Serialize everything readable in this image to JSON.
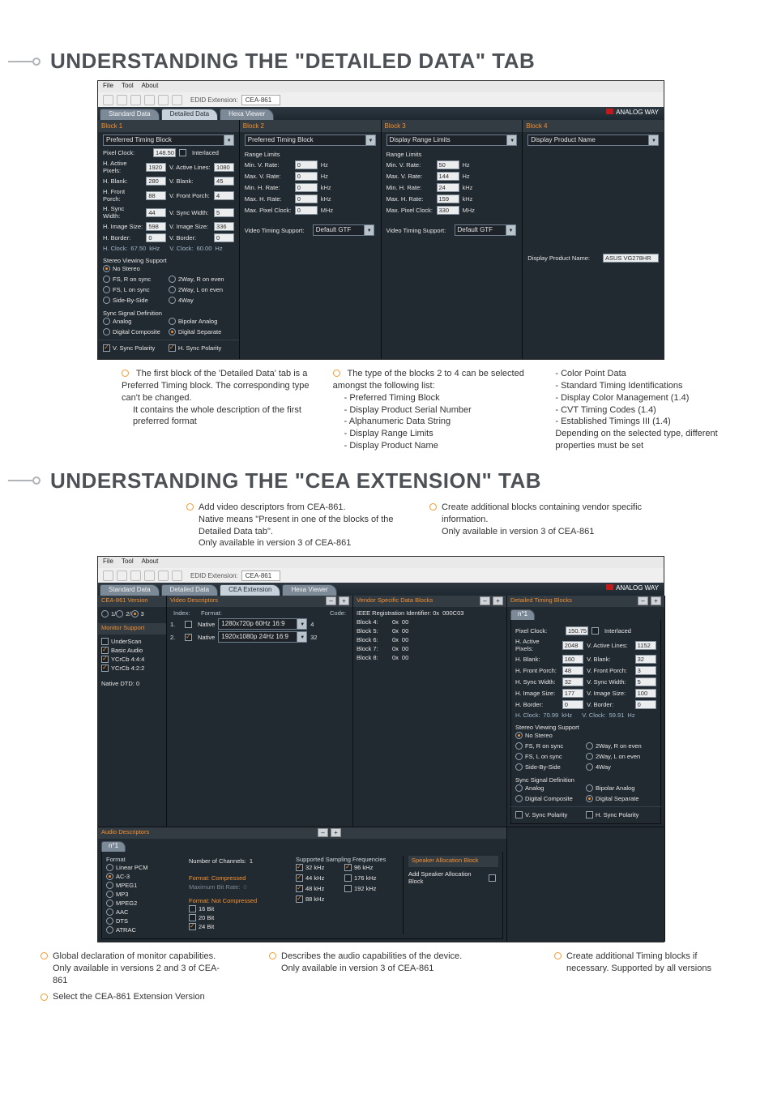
{
  "headings": {
    "h1": "UNDERSTANDING THE \"DETAILED DATA\" TAB",
    "h2": "UNDERSTANDING THE \"CEA EXTENSION\" TAB"
  },
  "menubar": {
    "file": "File",
    "tool": "Tool",
    "about": "About"
  },
  "toolbar": {
    "ext_label": "EDID Extension:",
    "ext_value": "CEA-861"
  },
  "brand": "ANALOG WAY",
  "detailed": {
    "tabs": {
      "standard": "Standard Data",
      "detailed": "Detailed Data",
      "hexa": "Hexa Viewer"
    },
    "blocks": {
      "b1": {
        "title": "Block 1",
        "type": "Preferred Timing Block",
        "pixelClock": "148.50",
        "interlaced": "Interlaced",
        "hActive": "1920",
        "vActive": "1080",
        "hBlank": "280",
        "vBlank": "45",
        "hFront": "88",
        "vFront": "4",
        "hSync": "44",
        "vSync": "5",
        "hImg": "598",
        "vImg": "336",
        "hBorder": "0",
        "vBorder": "0",
        "hClock": "67.50",
        "vClock": "60.00",
        "labels": {
          "pixelClock": "Pixel Clock:",
          "interlaced": "Interlaced",
          "hActive": "H. Active Pixels:",
          "vActive": "V. Active Lines:",
          "hBlank": "H. Blank:",
          "vBlank": "V. Blank:",
          "hFront": "H. Front Porch:",
          "vFront": "V. Front Porch:",
          "hSync": "H. Sync Width:",
          "vSync": "V. Sync Width:",
          "hImg": "H. Image Size:",
          "vImg": "V. Image Size:",
          "hBorder": "H. Border:",
          "vBorder": "V. Border:",
          "hClockPre": "H. Clock:",
          "hClockSuf": "kHz",
          "vClockPre": "V. Clock:",
          "vClockSuf": "Hz"
        },
        "stereoHead": "Stereo Viewing Support",
        "stereo": [
          "No Stereo",
          "FS, R on sync",
          "2Way, R on even",
          "FS, L on sync",
          "2Way, L on even",
          "Side-By-Side",
          "4Way"
        ],
        "syncHead": "Sync Signal Definition",
        "sync": [
          "Analog",
          "Bipolar Analog",
          "Digital Composite",
          "Digital Separate"
        ],
        "vpol": "V. Sync Polarity",
        "hpol": "H. Sync Polarity"
      },
      "b2": {
        "title": "Block 2",
        "type": "Preferred Timing Block",
        "head": "Range Limits",
        "minV": "0",
        "maxV": "0",
        "minH": "0",
        "maxH": "0",
        "maxP": "0",
        "labels": {
          "minV": "Min. V. Rate:",
          "maxV": "Max. V. Rate:",
          "minH": "Min. H. Rate:",
          "maxH": "Max. H. Rate:",
          "maxP": "Max. Pixel Clock:"
        },
        "units": {
          "hz": "Hz",
          "khz": "kHz",
          "mhz": "MHz"
        },
        "vts_l": "Video Timing Support:",
        "vts_v": "Default GTF"
      },
      "b3": {
        "title": "Block 3",
        "type": "Display Range Limits",
        "head": "Range Limits",
        "minV": "50",
        "maxV": "144",
        "minH": "24",
        "maxH": "159",
        "maxP": "330",
        "vts_l": "Video Timing Support:",
        "vts_v": "Default GTF"
      },
      "b4": {
        "title": "Block 4",
        "type": "Display Product Name",
        "dp_label": "Display Product Name:",
        "dp_value": "ASUS VG278HR"
      }
    }
  },
  "callouts1": {
    "left1": "The first block of the 'Detailed Data' tab is a Preferred Timing block.  The corresponding type can't be changed.",
    "left2": "It contains the whole description of the first preferred format",
    "mid_head": "The type of the blocks 2 to 4 can be selected amongst the following list:",
    "mid": [
      "- Preferred Timing Block",
      "- Display Product Serial Number",
      "- Alphanumeric Data String",
      "- Display Range Limits",
      "- Display Product Name"
    ],
    "right": [
      "- Color Point Data",
      "- Standard Timing Identifications",
      "- Display Color Management (1.4)",
      "- CVT Timing Codes (1.4)",
      "- Established Timings III (1.4)",
      "Depending on the selected type, different properties must be set"
    ]
  },
  "cea_notes_top": {
    "left": "Add video descriptors from CEA-861.\nNative means \"Present in one of the blocks of the Detailed Data tab\".\nOnly available in version 3 of CEA-861",
    "right": "Create additional blocks containing vendor specific information.\nOnly available in version 3 of CEA-861"
  },
  "cea": {
    "tabs": {
      "standard": "Standard Data",
      "detailed": "Detailed Data",
      "cea": "CEA Extension",
      "hexa": "Hexa Viewer"
    },
    "side": {
      "ver_head": "CEA-861 Version",
      "v1": "1",
      "v2": "2",
      "v3": "3",
      "mon_head": "Monitor Support",
      "mon": [
        "UnderScan",
        "Basic Audio",
        "YCrCb 4:4:4",
        "YCrCb 4:2:2"
      ],
      "dtd_label": "Native DTD:",
      "dtd_val": "0"
    },
    "video": {
      "head": "Video Descriptors",
      "cols": {
        "idx": "Index:",
        "fmt": "Format:",
        "code": "Code:"
      },
      "rows": [
        {
          "i": "1.",
          "native": "Native",
          "fmt": "1280x720p 60Hz 16:9",
          "code": "4"
        },
        {
          "i": "2.",
          "native": "Native",
          "fmt": "1920x1080p 24Hz 16:9",
          "code": "32"
        }
      ]
    },
    "vendor": {
      "head": "Vendor Specific Data Blocks",
      "ieee_l": "IEEE Registration Identifier:  0x",
      "ieee_v": "000C03",
      "blocks": [
        {
          "l": "Block 4:",
          "v": "00"
        },
        {
          "l": "Block 5:",
          "v": "00"
        },
        {
          "l": "Block 6:",
          "v": "00"
        },
        {
          "l": "Block 7:",
          "v": "00"
        },
        {
          "l": "Block 8:",
          "v": "00"
        }
      ],
      "zx": "0x"
    },
    "dtb": {
      "head": "Detailed Timing Blocks",
      "tab": "n°1",
      "pixelClock": "150.75",
      "interlaced": "Interlaced",
      "hActive": "2048",
      "vActive": "1152",
      "hBlank": "160",
      "vBlank": "32",
      "hFront": "48",
      "vFront": "3",
      "hSync": "32",
      "vSync": "5",
      "hImg": "177",
      "vImg": "100",
      "hBorder": "0",
      "vBorder": "0",
      "hClock": "70.99",
      "vClock": "59.91",
      "stereoHead": "Stereo Viewing Support",
      "stereo": [
        "No Stereo",
        "FS, R on sync",
        "2Way, R on even",
        "FS, L on sync",
        "2Way, L on even",
        "Side-By-Side",
        "4Way"
      ],
      "syncHead": "Sync Signal Definition",
      "sync": [
        "Analog",
        "Bipolar Analog",
        "Digital Composite",
        "Digital Separate"
      ],
      "vpol": "V. Sync Polarity",
      "hpol": "H. Sync Polarity"
    },
    "audio": {
      "head": "Audio Descriptors",
      "tab": "n°1",
      "fmt_l": "Format",
      "ch_l": "Number of Channels:",
      "ch_v": "1",
      "fmts": [
        "Linear PCM",
        "AC-3",
        "MPEG1",
        "MP3",
        "MPEG2",
        "AAC",
        "DTS",
        "ATRAC"
      ],
      "fc_l": "Format: Compressed",
      "mb_l": "Maximum Bit Rate:",
      "mb_v": "0",
      "fnc_l": "Format: Not Compressed",
      "bits": [
        "16 Bit",
        "20 Bit",
        "24 Bit"
      ],
      "ssf_l": "Supported Sampling Frequencies",
      "ssf": [
        "32 kHz",
        "96 kHz",
        "44 kHz",
        "176 kHz",
        "48 kHz",
        "192 kHz",
        "88 kHz"
      ]
    },
    "speaker": {
      "head": "Speaker Allocation Block",
      "opt": "Add Speaker Allocation Block"
    }
  },
  "callouts2": {
    "a": "Global declaration of monitor capabilities. Only available in versions 2 and 3 of CEA-861",
    "b": "Describes the audio capabilities of the device.\nOnly available in version 3 of CEA-861",
    "c": "Create additional Timing blocks if necessary. Supported by all versions",
    "d": "Select the CEA-861 Extension Version"
  },
  "signs": {
    "plus": "+",
    "minus": "–"
  }
}
